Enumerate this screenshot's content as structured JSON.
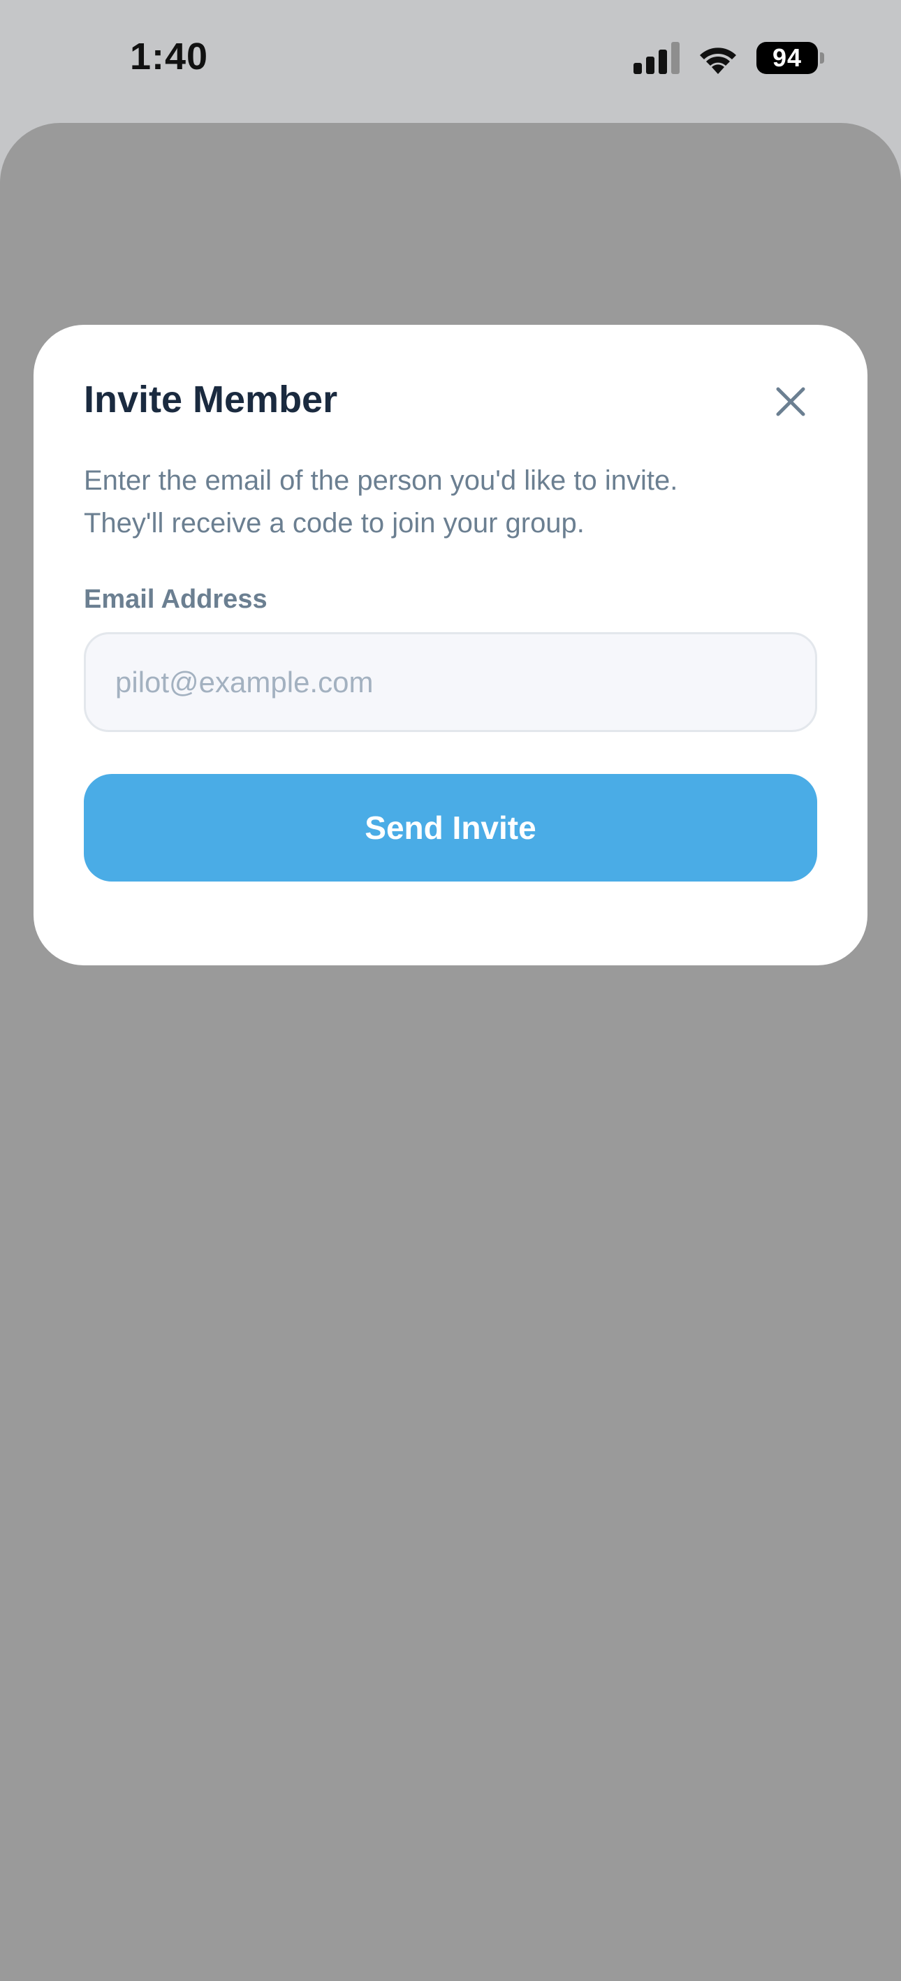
{
  "status_bar": {
    "time": "1:40",
    "battery_level": "94",
    "icons": [
      "signal-icon",
      "wifi-icon",
      "battery-icon"
    ]
  },
  "modal": {
    "title": "Invite Member",
    "description_line1": "Enter the email of the person you'd like to invite.",
    "description_line2": "They'll receive a code to join your group.",
    "email_label": "Email Address",
    "email_value": "",
    "email_placeholder": "pilot@example.com",
    "send_label": "Send Invite",
    "close_icon": "close-icon"
  },
  "colors": {
    "accent": "#4aace6",
    "title_text": "#1a2a3f",
    "secondary_text": "#6b7f91",
    "overlay": "#9a9a9a",
    "status_bar_bg": "#c5c6c8"
  }
}
